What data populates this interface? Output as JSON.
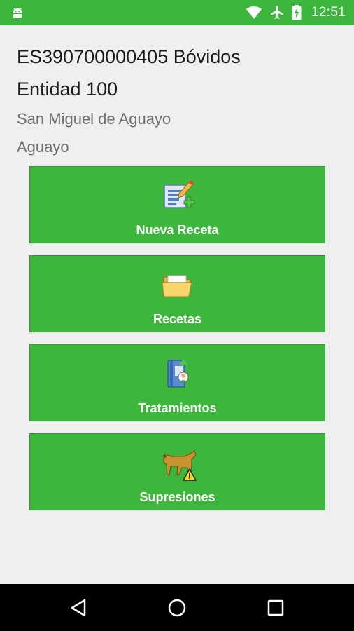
{
  "status_bar": {
    "time": "12:51",
    "left_icon": "android-debug-icon",
    "right_icons": [
      "wifi-icon",
      "airplane-mode-icon",
      "battery-charging-icon"
    ]
  },
  "header": {
    "title": "ES390700000405 Bóvidos",
    "entity": "Entidad 100",
    "location": "San Miguel de Aguayo",
    "municipality": "Aguayo"
  },
  "menu": {
    "items": [
      {
        "label": "Nueva Receta",
        "icon": "new-prescription-icon"
      },
      {
        "label": "Recetas",
        "icon": "folder-icon"
      },
      {
        "label": "Tratamientos",
        "icon": "treatment-book-icon"
      },
      {
        "label": "Supresiones",
        "icon": "withdrawal-warning-icon"
      }
    ]
  },
  "nav_bar": {
    "buttons": [
      "back-icon",
      "home-icon",
      "recents-icon"
    ]
  },
  "colors": {
    "primary_green": "#3bb53b",
    "background": "#efefef",
    "nav_bar": "#000000"
  }
}
